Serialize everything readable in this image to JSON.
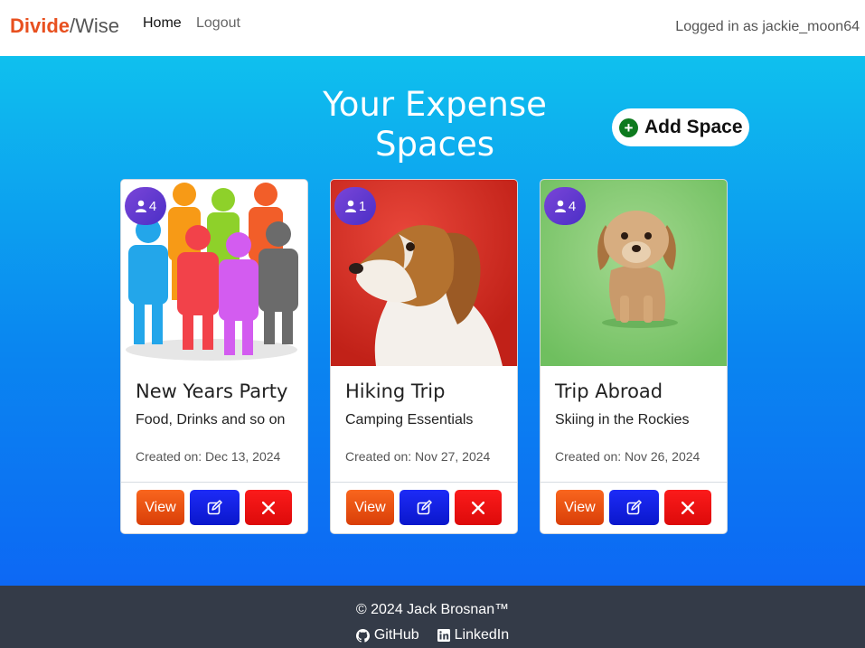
{
  "nav": {
    "brand_part1": "Divide",
    "brand_part2": "/Wise",
    "home": "Home",
    "logout": "Logout",
    "logged_in": "Logged in as jackie_moon64"
  },
  "main": {
    "title_line1": "Your Expense",
    "title_line2": "Spaces",
    "add_space_label": "Add Space",
    "add_space_icon": "+"
  },
  "cards": [
    {
      "members": "4",
      "title": "New Years Party",
      "description": "Food, Drinks and so on",
      "created": "Created on: Dec 13, 2024",
      "view_label": "View",
      "image": "group-of-people-figures"
    },
    {
      "members": "1",
      "title": "Hiking Trip",
      "description": "Camping Essentials",
      "created": "Created on: Nov 27, 2024",
      "view_label": "View",
      "image": "beagle-on-red-background"
    },
    {
      "members": "4",
      "title": "Trip Abroad",
      "description": "Skiing in the Rockies",
      "created": "Created on: Nov 26, 2024",
      "view_label": "View",
      "image": "small-dog-on-green-background"
    }
  ],
  "footer": {
    "copyright": "© 2024 Jack Brosnan™",
    "github": "GitHub",
    "linkedin": "LinkedIn"
  },
  "colors": {
    "brand_accent": "#e8501f",
    "view_button": "#f25a15",
    "edit_button": "#1422e8",
    "delete_button": "#f31414",
    "badge": "#6a3fd3",
    "add_icon": "#0d7a1e",
    "footer_bg": "#343b48"
  }
}
